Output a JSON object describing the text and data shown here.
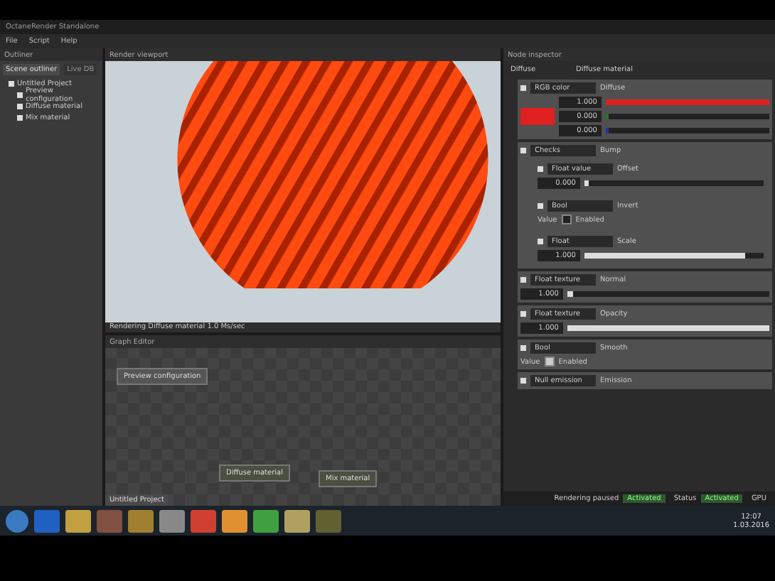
{
  "window": {
    "title": "OctaneRender Standalone"
  },
  "menu": [
    "File",
    "Script",
    "Help"
  ],
  "outliner": {
    "title": "Outliner",
    "tabs": [
      {
        "label": "Scene outliner",
        "selected": true
      },
      {
        "label": "Live DB",
        "selected": false
      }
    ],
    "tree": [
      {
        "label": "Untitled Project",
        "children": [
          {
            "label": "Preview configuration"
          },
          {
            "label": "Diffuse material"
          },
          {
            "label": "Mix material"
          }
        ]
      }
    ]
  },
  "viewport": {
    "title": "Render viewport",
    "status": "Rendering Diffuse material 1.0 Ms/sec"
  },
  "graph": {
    "title": "Graph Editor",
    "tab": "Untitled Project",
    "nodes": [
      {
        "label": "Preview configuration",
        "kind": "config"
      },
      {
        "label": "Diffuse material",
        "kind": "material"
      },
      {
        "label": "Mix material",
        "kind": "material"
      }
    ]
  },
  "inspector": {
    "title": "Node inspector",
    "node": "Diffuse",
    "type": "Diffuse material",
    "rows": [
      {
        "kind": "color",
        "node": "RGB color",
        "pin": "Diffuse",
        "channels": [
          {
            "value": "1.000",
            "level": 1,
            "color": "#e02020"
          },
          {
            "value": "0.000",
            "level": 0.02,
            "color": "#207a20"
          },
          {
            "value": "0.000",
            "level": 0.02,
            "color": "#2030c0"
          }
        ]
      },
      {
        "kind": "group",
        "node": "Checks",
        "pin": "Bump",
        "children": [
          {
            "kind": "float",
            "node": "Float value",
            "pin": "Offset",
            "value": "0.000",
            "level": 0.02
          },
          {
            "kind": "bool",
            "node": "Bool",
            "pin": "Invert",
            "label": "Value",
            "option": "Enabled",
            "checked": false
          },
          {
            "kind": "float",
            "node": "Float",
            "pin": "Scale",
            "value": "1.000",
            "level": 0.9
          }
        ]
      },
      {
        "kind": "float",
        "node": "Float texture",
        "pin": "Normal",
        "value": "1.000",
        "level": 0.03
      },
      {
        "kind": "float",
        "node": "Float texture",
        "pin": "Opacity",
        "value": "1.000",
        "level": 1
      },
      {
        "kind": "bool",
        "node": "Bool",
        "pin": "Smooth",
        "label": "Value",
        "option": "Enabled",
        "checked": true
      },
      {
        "kind": "plain",
        "node": "Null emission",
        "pin": "Emission"
      }
    ]
  },
  "status": [
    {
      "label": "Rendering paused",
      "value": "Activated"
    },
    {
      "label": "Status",
      "value": "Activated"
    },
    {
      "label": "GPU"
    }
  ],
  "taskbar": {
    "time": "12:07",
    "date": "1.03.2016"
  }
}
